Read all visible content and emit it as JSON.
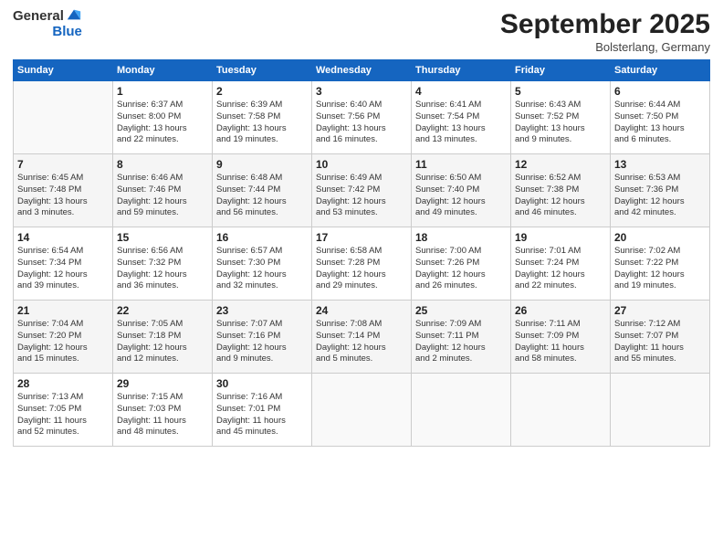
{
  "header": {
    "logo_general": "General",
    "logo_blue": "Blue",
    "month_title": "September 2025",
    "subtitle": "Bolsterlang, Germany"
  },
  "days_of_week": [
    "Sunday",
    "Monday",
    "Tuesday",
    "Wednesday",
    "Thursday",
    "Friday",
    "Saturday"
  ],
  "weeks": [
    [
      {
        "day": "",
        "detail": ""
      },
      {
        "day": "1",
        "detail": "Sunrise: 6:37 AM\nSunset: 8:00 PM\nDaylight: 13 hours\nand 22 minutes."
      },
      {
        "day": "2",
        "detail": "Sunrise: 6:39 AM\nSunset: 7:58 PM\nDaylight: 13 hours\nand 19 minutes."
      },
      {
        "day": "3",
        "detail": "Sunrise: 6:40 AM\nSunset: 7:56 PM\nDaylight: 13 hours\nand 16 minutes."
      },
      {
        "day": "4",
        "detail": "Sunrise: 6:41 AM\nSunset: 7:54 PM\nDaylight: 13 hours\nand 13 minutes."
      },
      {
        "day": "5",
        "detail": "Sunrise: 6:43 AM\nSunset: 7:52 PM\nDaylight: 13 hours\nand 9 minutes."
      },
      {
        "day": "6",
        "detail": "Sunrise: 6:44 AM\nSunset: 7:50 PM\nDaylight: 13 hours\nand 6 minutes."
      }
    ],
    [
      {
        "day": "7",
        "detail": "Sunrise: 6:45 AM\nSunset: 7:48 PM\nDaylight: 13 hours\nand 3 minutes."
      },
      {
        "day": "8",
        "detail": "Sunrise: 6:46 AM\nSunset: 7:46 PM\nDaylight: 12 hours\nand 59 minutes."
      },
      {
        "day": "9",
        "detail": "Sunrise: 6:48 AM\nSunset: 7:44 PM\nDaylight: 12 hours\nand 56 minutes."
      },
      {
        "day": "10",
        "detail": "Sunrise: 6:49 AM\nSunset: 7:42 PM\nDaylight: 12 hours\nand 53 minutes."
      },
      {
        "day": "11",
        "detail": "Sunrise: 6:50 AM\nSunset: 7:40 PM\nDaylight: 12 hours\nand 49 minutes."
      },
      {
        "day": "12",
        "detail": "Sunrise: 6:52 AM\nSunset: 7:38 PM\nDaylight: 12 hours\nand 46 minutes."
      },
      {
        "day": "13",
        "detail": "Sunrise: 6:53 AM\nSunset: 7:36 PM\nDaylight: 12 hours\nand 42 minutes."
      }
    ],
    [
      {
        "day": "14",
        "detail": "Sunrise: 6:54 AM\nSunset: 7:34 PM\nDaylight: 12 hours\nand 39 minutes."
      },
      {
        "day": "15",
        "detail": "Sunrise: 6:56 AM\nSunset: 7:32 PM\nDaylight: 12 hours\nand 36 minutes."
      },
      {
        "day": "16",
        "detail": "Sunrise: 6:57 AM\nSunset: 7:30 PM\nDaylight: 12 hours\nand 32 minutes."
      },
      {
        "day": "17",
        "detail": "Sunrise: 6:58 AM\nSunset: 7:28 PM\nDaylight: 12 hours\nand 29 minutes."
      },
      {
        "day": "18",
        "detail": "Sunrise: 7:00 AM\nSunset: 7:26 PM\nDaylight: 12 hours\nand 26 minutes."
      },
      {
        "day": "19",
        "detail": "Sunrise: 7:01 AM\nSunset: 7:24 PM\nDaylight: 12 hours\nand 22 minutes."
      },
      {
        "day": "20",
        "detail": "Sunrise: 7:02 AM\nSunset: 7:22 PM\nDaylight: 12 hours\nand 19 minutes."
      }
    ],
    [
      {
        "day": "21",
        "detail": "Sunrise: 7:04 AM\nSunset: 7:20 PM\nDaylight: 12 hours\nand 15 minutes."
      },
      {
        "day": "22",
        "detail": "Sunrise: 7:05 AM\nSunset: 7:18 PM\nDaylight: 12 hours\nand 12 minutes."
      },
      {
        "day": "23",
        "detail": "Sunrise: 7:07 AM\nSunset: 7:16 PM\nDaylight: 12 hours\nand 9 minutes."
      },
      {
        "day": "24",
        "detail": "Sunrise: 7:08 AM\nSunset: 7:14 PM\nDaylight: 12 hours\nand 5 minutes."
      },
      {
        "day": "25",
        "detail": "Sunrise: 7:09 AM\nSunset: 7:11 PM\nDaylight: 12 hours\nand 2 minutes."
      },
      {
        "day": "26",
        "detail": "Sunrise: 7:11 AM\nSunset: 7:09 PM\nDaylight: 11 hours\nand 58 minutes."
      },
      {
        "day": "27",
        "detail": "Sunrise: 7:12 AM\nSunset: 7:07 PM\nDaylight: 11 hours\nand 55 minutes."
      }
    ],
    [
      {
        "day": "28",
        "detail": "Sunrise: 7:13 AM\nSunset: 7:05 PM\nDaylight: 11 hours\nand 52 minutes."
      },
      {
        "day": "29",
        "detail": "Sunrise: 7:15 AM\nSunset: 7:03 PM\nDaylight: 11 hours\nand 48 minutes."
      },
      {
        "day": "30",
        "detail": "Sunrise: 7:16 AM\nSunset: 7:01 PM\nDaylight: 11 hours\nand 45 minutes."
      },
      {
        "day": "",
        "detail": ""
      },
      {
        "day": "",
        "detail": ""
      },
      {
        "day": "",
        "detail": ""
      },
      {
        "day": "",
        "detail": ""
      }
    ]
  ]
}
